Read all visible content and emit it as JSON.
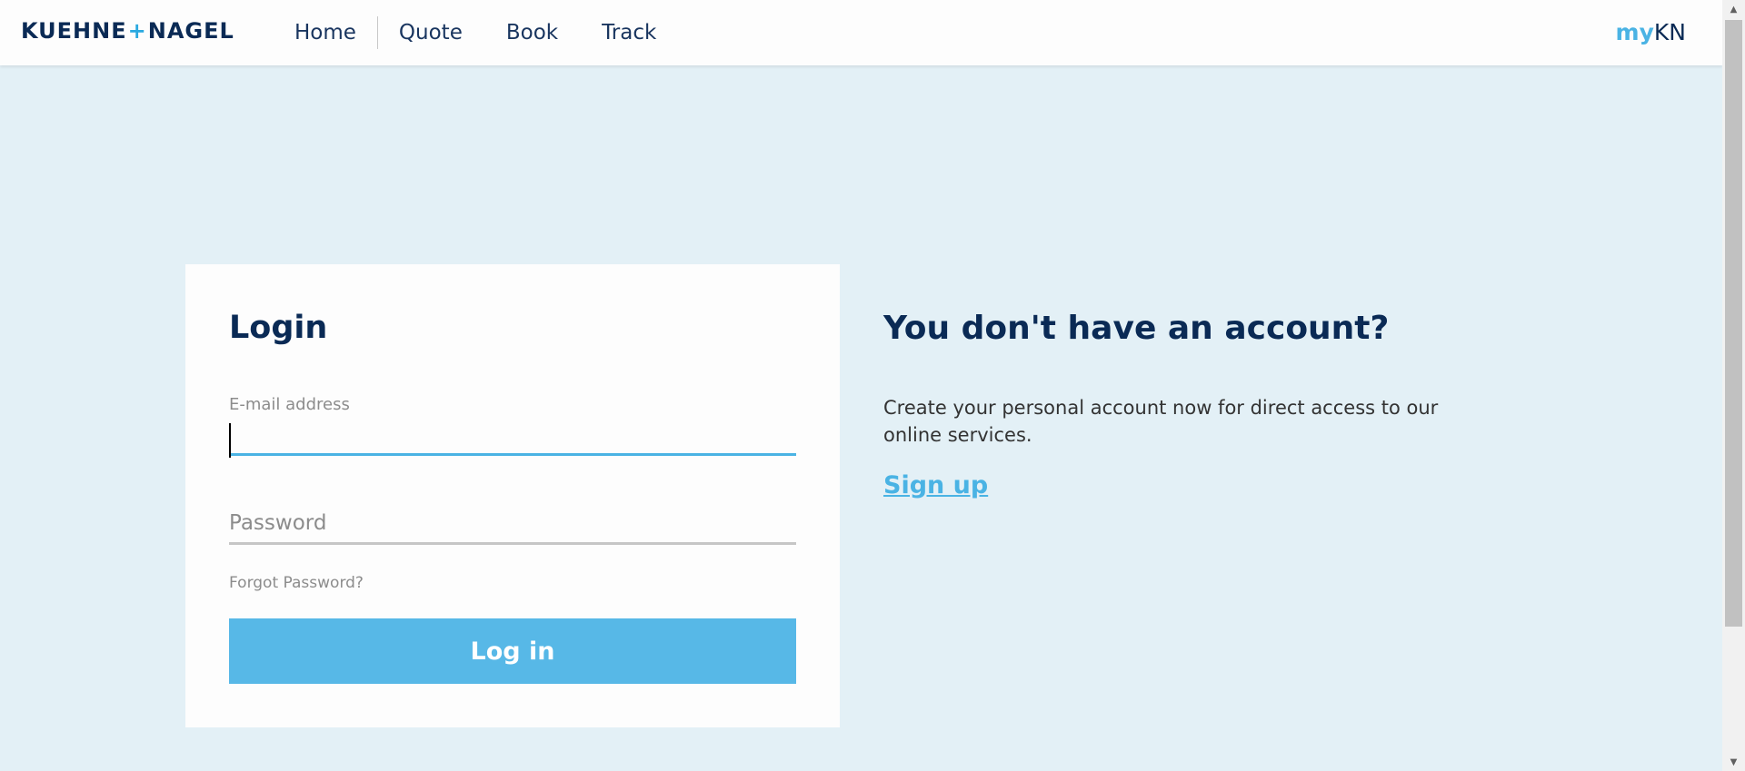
{
  "header": {
    "logo": {
      "left": "KUEHNE",
      "plus": "+",
      "right": "NAGEL"
    },
    "nav": [
      "Home",
      "Quote",
      "Book",
      "Track"
    ],
    "mykn": {
      "my": "my",
      "kn": "KN"
    }
  },
  "login": {
    "title": "Login",
    "email_label": "E-mail address",
    "email_value": "",
    "password_placeholder": "Password",
    "forgot_label": "Forgot Password?",
    "button_label": "Log in"
  },
  "signup": {
    "title": "You don't have an account?",
    "text": "Create your personal account now for direct access to our online services.",
    "link_label": "Sign up"
  },
  "colors": {
    "brand_navy": "#0a2a55",
    "accent_blue": "#4ab3e4",
    "button_blue": "#57b8e7",
    "page_background": "#e3f0f6"
  },
  "icons": {
    "scroll_up": "scroll-up-arrow-icon",
    "scroll_down": "scroll-down-arrow-icon"
  }
}
